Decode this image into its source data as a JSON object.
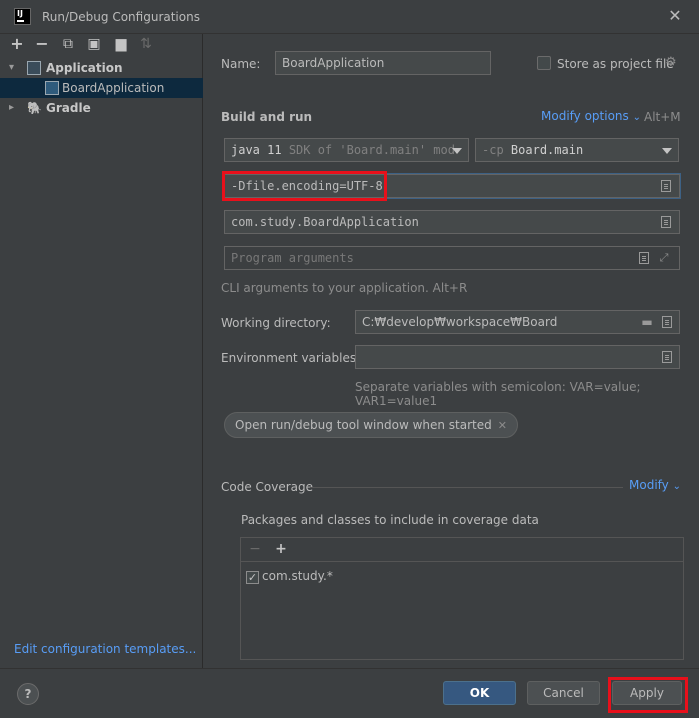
{
  "window": {
    "title": "Run/Debug Configurations",
    "logo_text": "IJ",
    "close_glyph": "✕"
  },
  "left": {
    "toolbar_icons": [
      "add-icon",
      "remove-icon",
      "copy-icon",
      "save-icon",
      "folder-add-icon",
      "sort-icon"
    ],
    "toolbar_glyphs": [
      "+",
      "−",
      "⧉",
      "▣",
      "▆",
      "⇅"
    ],
    "tree": [
      {
        "label": "Application",
        "expanded": true,
        "bold": true
      },
      {
        "label": "BoardApplication",
        "selected": true
      },
      {
        "label": "Gradle",
        "expanded": false,
        "bold": true
      }
    ],
    "edit_templates": "Edit configuration templates..."
  },
  "config": {
    "name_label": "Name:",
    "name_value": "BoardApplication",
    "store_label": "Store as project file",
    "store_checked": false,
    "build_run_title": "Build and run",
    "modify_options": "Modify options",
    "modify_shortcut": "Alt+M",
    "jdk_prefix": "java 11",
    "jdk_detail": "SDK of 'Board.main' mod",
    "cp_prefix": "-cp",
    "cp_value": "Board.main",
    "vm_options": "-Dfile.encoding=UTF-8",
    "main_class": "com.study.BoardApplication",
    "program_args_placeholder": "Program arguments",
    "cli_hint": "CLI arguments to your application. Alt+R",
    "workdir_label": "Working directory:",
    "workdir_value": "C:₩develop₩workspace₩Board",
    "env_label": "Environment variables:",
    "env_value": "",
    "env_hint": "Separate variables with semicolon: VAR=value; VAR1=value1",
    "chip_label": "Open run/debug tool window when started",
    "coverage_title": "Code Coverage",
    "coverage_modify": "Modify",
    "coverage_packages_label": "Packages and classes to include in coverage data",
    "coverage_items": [
      {
        "label": "com.study.*",
        "checked": true
      }
    ]
  },
  "buttons": {
    "help": "?",
    "ok": "OK",
    "cancel": "Cancel",
    "apply": "Apply"
  },
  "colors": {
    "accent_link": "#589df6",
    "highlight_red": "#e8101b",
    "primary_button": "#365880"
  }
}
